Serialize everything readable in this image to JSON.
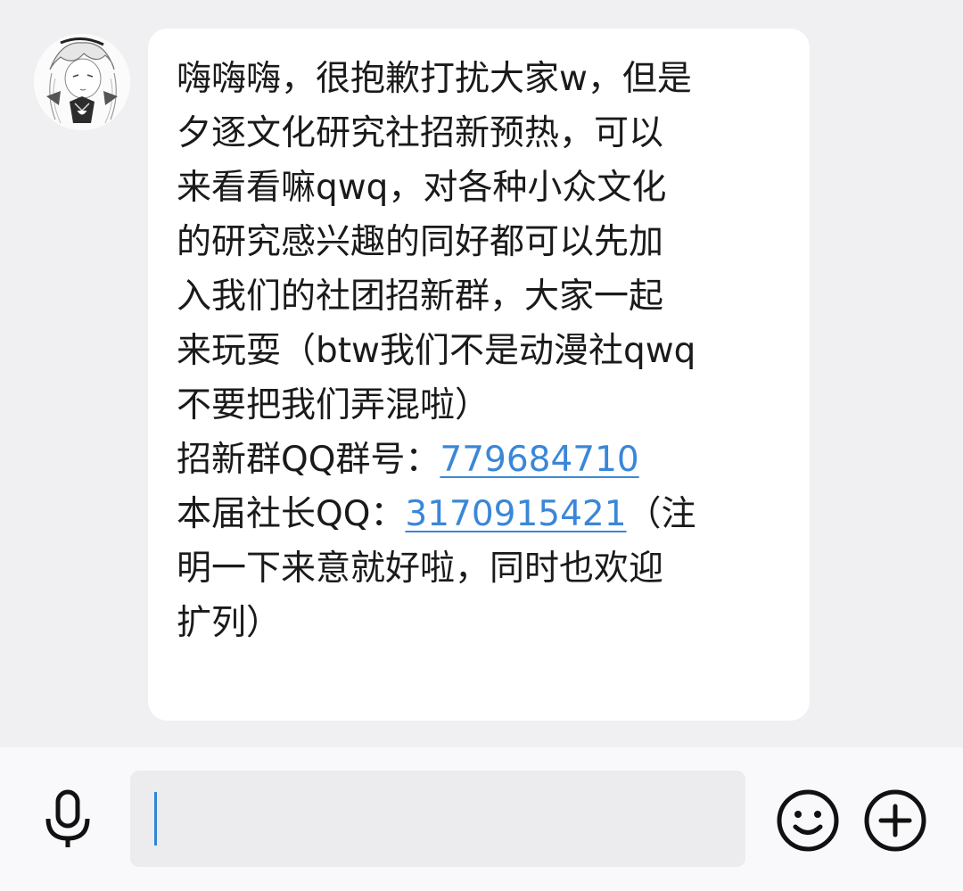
{
  "message": {
    "lines": [
      "嗨嗨嗨，很抱歉打扰大家w，但是",
      "夕逐文化研究社招新预热，可以",
      "来看看嘛qwq，对各种小众文化",
      "的研究感兴趣的同好都可以先加",
      "入我们的社团招新群，大家一起",
      "来玩耍（btw我们不是动漫社qwq",
      "不要把我们弄混啦）"
    ],
    "group_label": "招新群QQ群号：",
    "group_number": "779684710",
    "leader_label": "本届社长QQ：",
    "leader_number": "3170915421",
    "leader_suffix": "（注",
    "tail_lines": [
      "明一下来意就好啦，同时也欢迎",
      "扩列）"
    ]
  },
  "input": {
    "value": ""
  },
  "icons": {
    "avatar": "anime-avatar",
    "mic": "microphone-icon",
    "emoji": "smiley-icon",
    "plus": "plus-icon"
  },
  "colors": {
    "link": "#3a87d8",
    "caret": "#2f86d6",
    "background": "#f0f0f2",
    "bubble": "#ffffff"
  }
}
